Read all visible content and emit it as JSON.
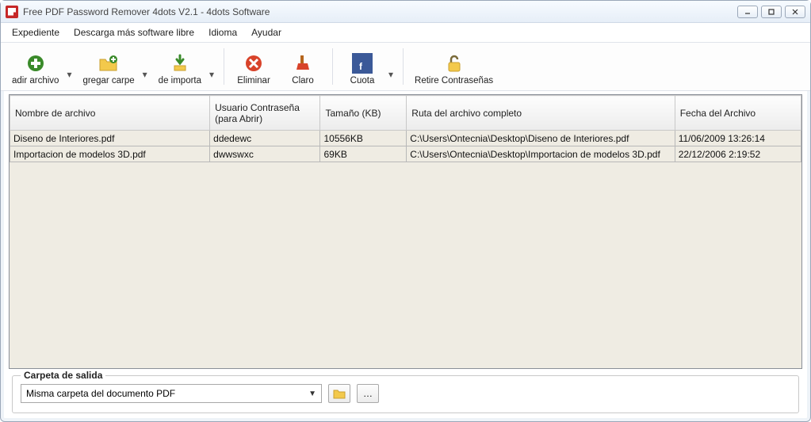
{
  "title": "Free PDF Password Remover 4dots V2.1 - 4dots Software",
  "menu": {
    "file": "Expediente",
    "download": "Descarga más software libre",
    "language": "Idioma",
    "help": "Ayudar"
  },
  "toolbar": {
    "add_file": "adir archivo",
    "add_folder": "gregar carpe",
    "import": "de importa",
    "delete": "Eliminar",
    "clear": "Claro",
    "quota": "Cuota",
    "remove_pw": "Retire Contraseñas"
  },
  "columns": {
    "filename": "Nombre de archivo",
    "password": "Usuario Contraseña (para Abrir)",
    "size": "Tamaño (KB)",
    "path": "Ruta del archivo completo",
    "date": "Fecha del Archivo"
  },
  "rows": [
    {
      "filename": "Diseno de Interiores.pdf",
      "password": "ddedewc",
      "size": "10556KB",
      "path": "C:\\Users\\Ontecnia\\Desktop\\Diseno de Interiores.pdf",
      "date": "11/06/2009 13:26:14"
    },
    {
      "filename": "Importacion de modelos 3D.pdf",
      "password": "dwwswxc",
      "size": "69KB",
      "path": "C:\\Users\\Ontecnia\\Desktop\\Importacion de modelos 3D.pdf",
      "date": "22/12/2006 2:19:52"
    }
  ],
  "output": {
    "legend": "Carpeta de salida",
    "option": "Misma carpeta del documento PDF"
  }
}
